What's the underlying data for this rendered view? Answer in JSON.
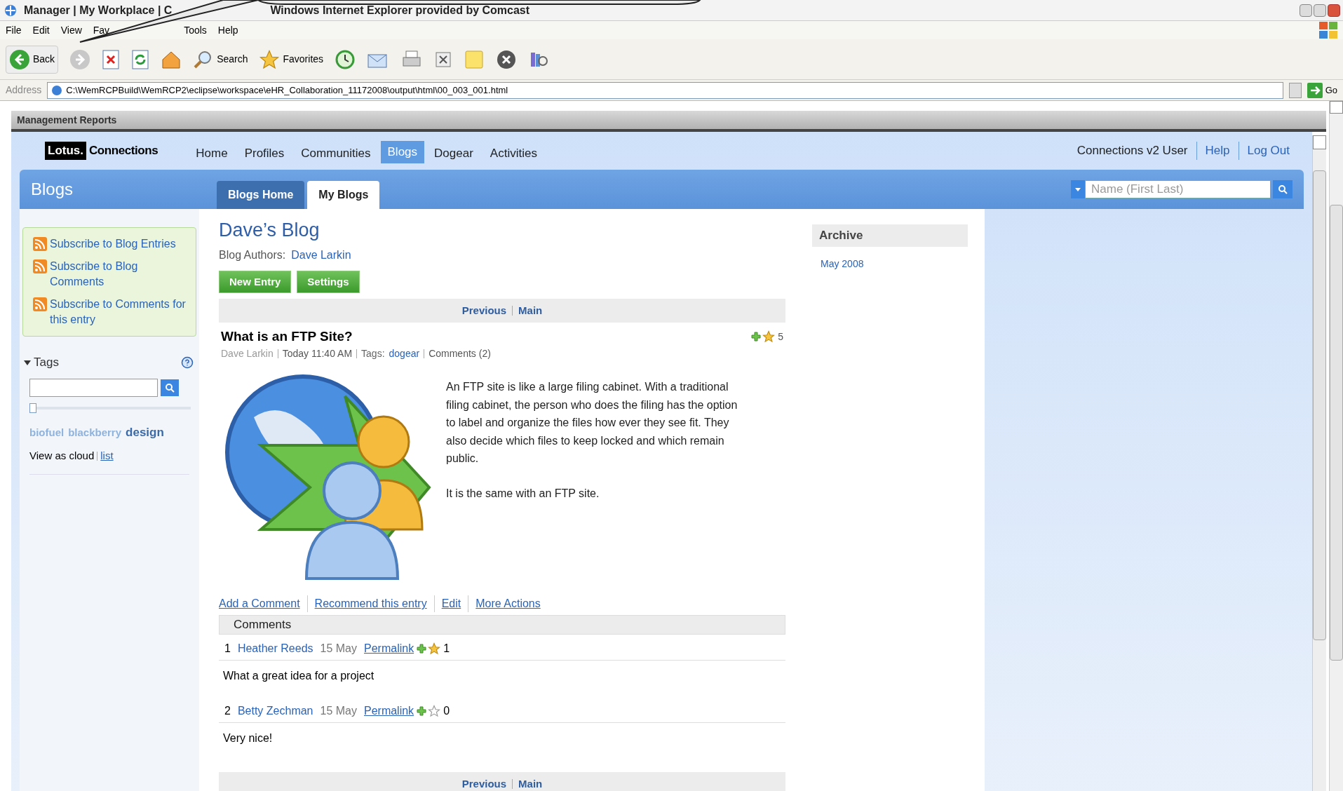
{
  "window": {
    "title_start": "Manager | My Workplace | C",
    "title_end": "Windows Internet Explorer provided by Comcast"
  },
  "menu": [
    "File",
    "Edit",
    "View",
    "Fav",
    "Tools",
    "Help"
  ],
  "toolbar": {
    "back": "Back",
    "search": "Search",
    "favorites": "Favorites"
  },
  "address": {
    "label": "Address",
    "value": "C:\\WemRCPBuild\\WemRCP2\\eclipse\\workspace\\eHR_Collaboration_11172008\\output\\html\\00_003_001.html",
    "go": "Go"
  },
  "reports_bar": "Management Reports",
  "logo": {
    "brand": "Lotus.",
    "product": "Connections"
  },
  "nav": [
    {
      "label": "Home",
      "selected": false
    },
    {
      "label": "Profiles",
      "selected": false
    },
    {
      "label": "Communities",
      "selected": false
    },
    {
      "label": "Blogs",
      "selected": true
    },
    {
      "label": "Dogear",
      "selected": false
    },
    {
      "label": "Activities",
      "selected": false
    }
  ],
  "user_links": [
    {
      "label": "Connections v2 User",
      "kind": "text"
    },
    {
      "label": "Help",
      "kind": "link"
    },
    {
      "label": "Log Out",
      "kind": "link"
    }
  ],
  "section_title": "Blogs",
  "tabs": [
    {
      "label": "Blogs Home",
      "selected": false
    },
    {
      "label": "My Blogs",
      "selected": true
    }
  ],
  "people_search": {
    "placeholder": "Name (First Last)"
  },
  "subscriptions": [
    "Subscribe to Blog Entries",
    "Subscribe to Blog Comments",
    "Subscribe to Comments for this entry"
  ],
  "tags": {
    "title": "Tags",
    "expanded": true,
    "slider": {
      "level": 0
    },
    "cloud": [
      {
        "label": "biofuel",
        "prominent": false
      },
      {
        "label": "blackberry",
        "prominent": false
      },
      {
        "label": "design",
        "prominent": true
      }
    ],
    "view_as": "View as cloud",
    "list_link": "list"
  },
  "blog": {
    "title": "Dave’s Blog",
    "authors_label": "Blog Authors:",
    "author": "Dave Larkin",
    "buttons": [
      "New Entry",
      "Settings"
    ],
    "pager": [
      "Previous",
      "Main"
    ]
  },
  "entry": {
    "title": "What is an FTP Site?",
    "starred": true,
    "rating": "5",
    "author": "Dave Larkin",
    "time": "Today 11:40 AM",
    "tags_label": "Tags:",
    "tag": "dogear",
    "comments_count": "Comments (2)",
    "paragraphs": [
      "An FTP site is like a large filing cabinet. With a traditional filing cabinet, the person who does the filing has the option to label and organize the files how ever they see fit. They also decide which files to keep locked and which remain public.",
      "It is the same with an FTP site."
    ],
    "actions": [
      "Add a Comment",
      "Recommend this entry",
      "Edit",
      "More Actions"
    ]
  },
  "comments": {
    "title": "Comments",
    "items": [
      {
        "number": "1",
        "author": "Heather Reeds",
        "date": "15 May",
        "permalink": "Permalink",
        "starred": true,
        "rating": "1",
        "text": "What a great idea for a project"
      },
      {
        "number": "2",
        "author": "Betty Zechman",
        "date": "15 May",
        "permalink": "Permalink",
        "starred": false,
        "rating": "0",
        "text": "Very nice!"
      }
    ]
  },
  "bottom_pager": [
    "Previous",
    "Main"
  ],
  "archive": {
    "title": "Archive",
    "items": [
      "May 2008"
    ]
  }
}
